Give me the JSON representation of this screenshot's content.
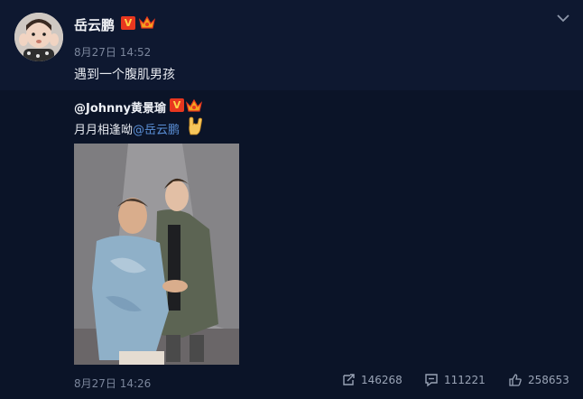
{
  "post": {
    "author": "岳云鹏",
    "verified_mark": "V",
    "time": "8月27日 14:52",
    "text": "遇到一个腹肌男孩"
  },
  "repost": {
    "author": "@Johnny黄景瑜",
    "verified_mark": "V",
    "text_prefix": "月月相逢呦",
    "mention": "@岳云鹏",
    "time": "8月27日 14:26",
    "actions": {
      "repost_count": "146268",
      "comment_count": "111221",
      "like_count": "258653"
    }
  },
  "colors": {
    "background": "#0b1428",
    "mention": "#5a8fd6",
    "meta_text": "#7b869c",
    "badge_red": "#e8371f"
  },
  "icons": [
    "chevron-down-icon",
    "crown-icon",
    "rock-hand-icon",
    "repost-icon",
    "comment-icon",
    "like-icon"
  ]
}
